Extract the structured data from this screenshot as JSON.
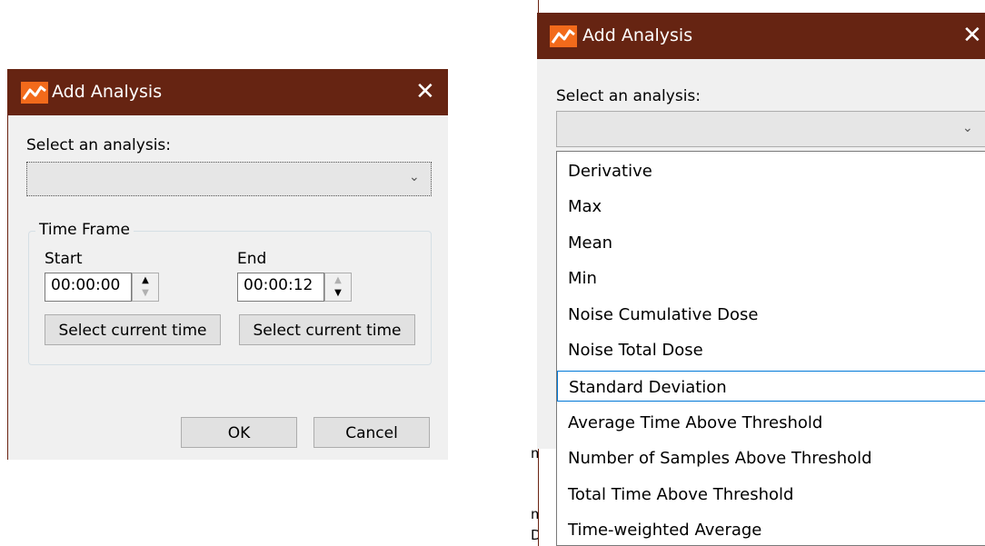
{
  "left_dialog": {
    "title": "Add Analysis",
    "close_glyph": "✕",
    "select_label": "Select an analysis:",
    "analysis_value": "",
    "group_title": "Time Frame",
    "start": {
      "label": "Start",
      "value": "00:00:00",
      "select_button": "Select current time"
    },
    "end": {
      "label": "End",
      "value": "00:00:12",
      "select_button": "Select current time"
    },
    "ok_label": "OK",
    "cancel_label": "Cancel"
  },
  "right_dialog": {
    "title": "Add Analysis",
    "close_glyph": "✕",
    "select_label": "Select an analysis:",
    "analysis_value": "",
    "options": [
      "Derivative",
      "Max",
      "Mean",
      "Min",
      "Noise Cumulative Dose",
      "Noise Total Dose",
      "Standard Deviation",
      "Average Time Above Threshold",
      "Number of Samples Above Threshold",
      "Total Time Above Threshold",
      "Time-weighted Average"
    ],
    "highlighted_option": "Standard Deviation"
  },
  "background_fragments": [
    "mo",
    "mo",
    "D"
  ],
  "colors": {
    "titlebar": "#662412",
    "dialog_bg": "#f0f0f0",
    "selection_border": "#0078d7",
    "icon_orange": "#f26a1b"
  },
  "icons": [
    "analysis-chart-icon",
    "close-icon",
    "chevron-down-icon",
    "spin-up-icon",
    "spin-down-icon"
  ]
}
